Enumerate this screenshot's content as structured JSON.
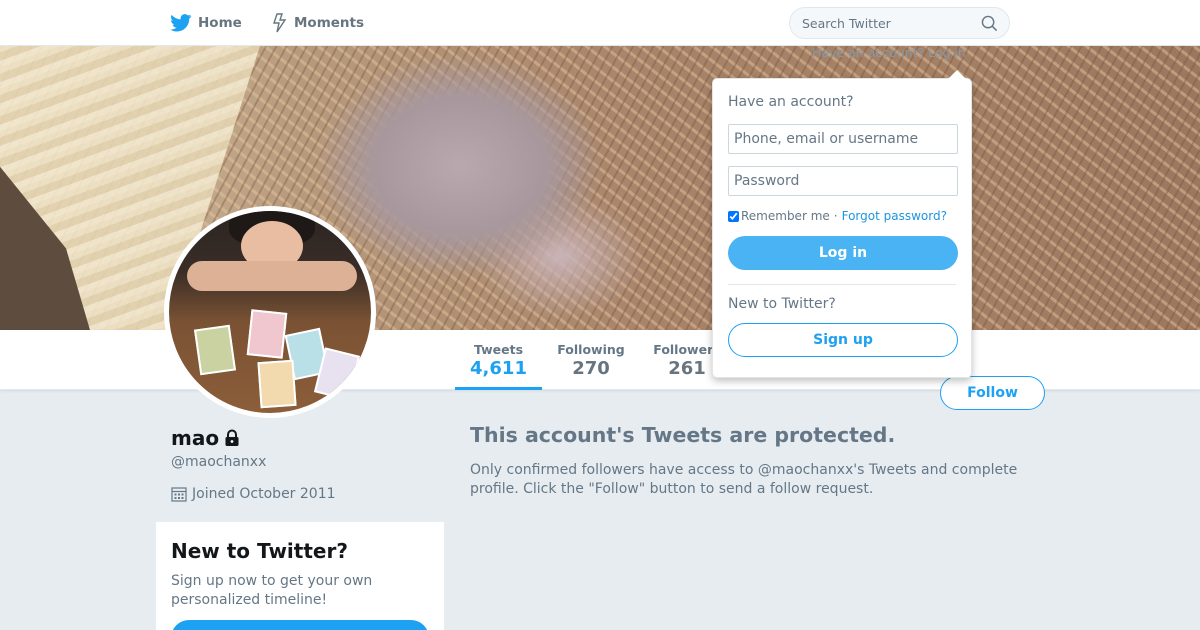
{
  "nav": {
    "home_label": "Home",
    "moments_label": "Moments",
    "search_placeholder": "Search Twitter",
    "home_icon": "bird-icon",
    "moments_icon": "lightning-icon",
    "search_icon": "search-icon",
    "brand_color": "#1da1f2"
  },
  "login_hint": "Have an account? Log in",
  "profile": {
    "name": "mao",
    "handle": "@maochanxx",
    "joined": "Joined October 2011",
    "lock_icon": "lock-icon",
    "calendar_icon": "calendar-icon"
  },
  "stats": {
    "tweets_label": "Tweets",
    "tweets_value": "4,611",
    "following_label": "Following",
    "following_value": "270",
    "followers_label": "Followers",
    "followers_value": "261"
  },
  "follow_label": "Follow",
  "protected": {
    "title": "This account's Tweets are protected.",
    "body": "Only confirmed followers have access to @maochanxx's Tweets and complete profile. Click the \"Follow\" button to send a follow request."
  },
  "signup_card": {
    "title": "New to Twitter?",
    "body": "Sign up now to get your own personalized timeline!"
  },
  "login_dropdown": {
    "heading": "Have an account?",
    "username_placeholder": "Phone, email or username",
    "password_placeholder": "Password",
    "remember_label": "Remember me",
    "separator": "·",
    "forgot_label": "Forgot password?",
    "login_label": "Log in",
    "new_label": "New to Twitter?",
    "signup_label": "Sign up",
    "remember_checked": true
  }
}
